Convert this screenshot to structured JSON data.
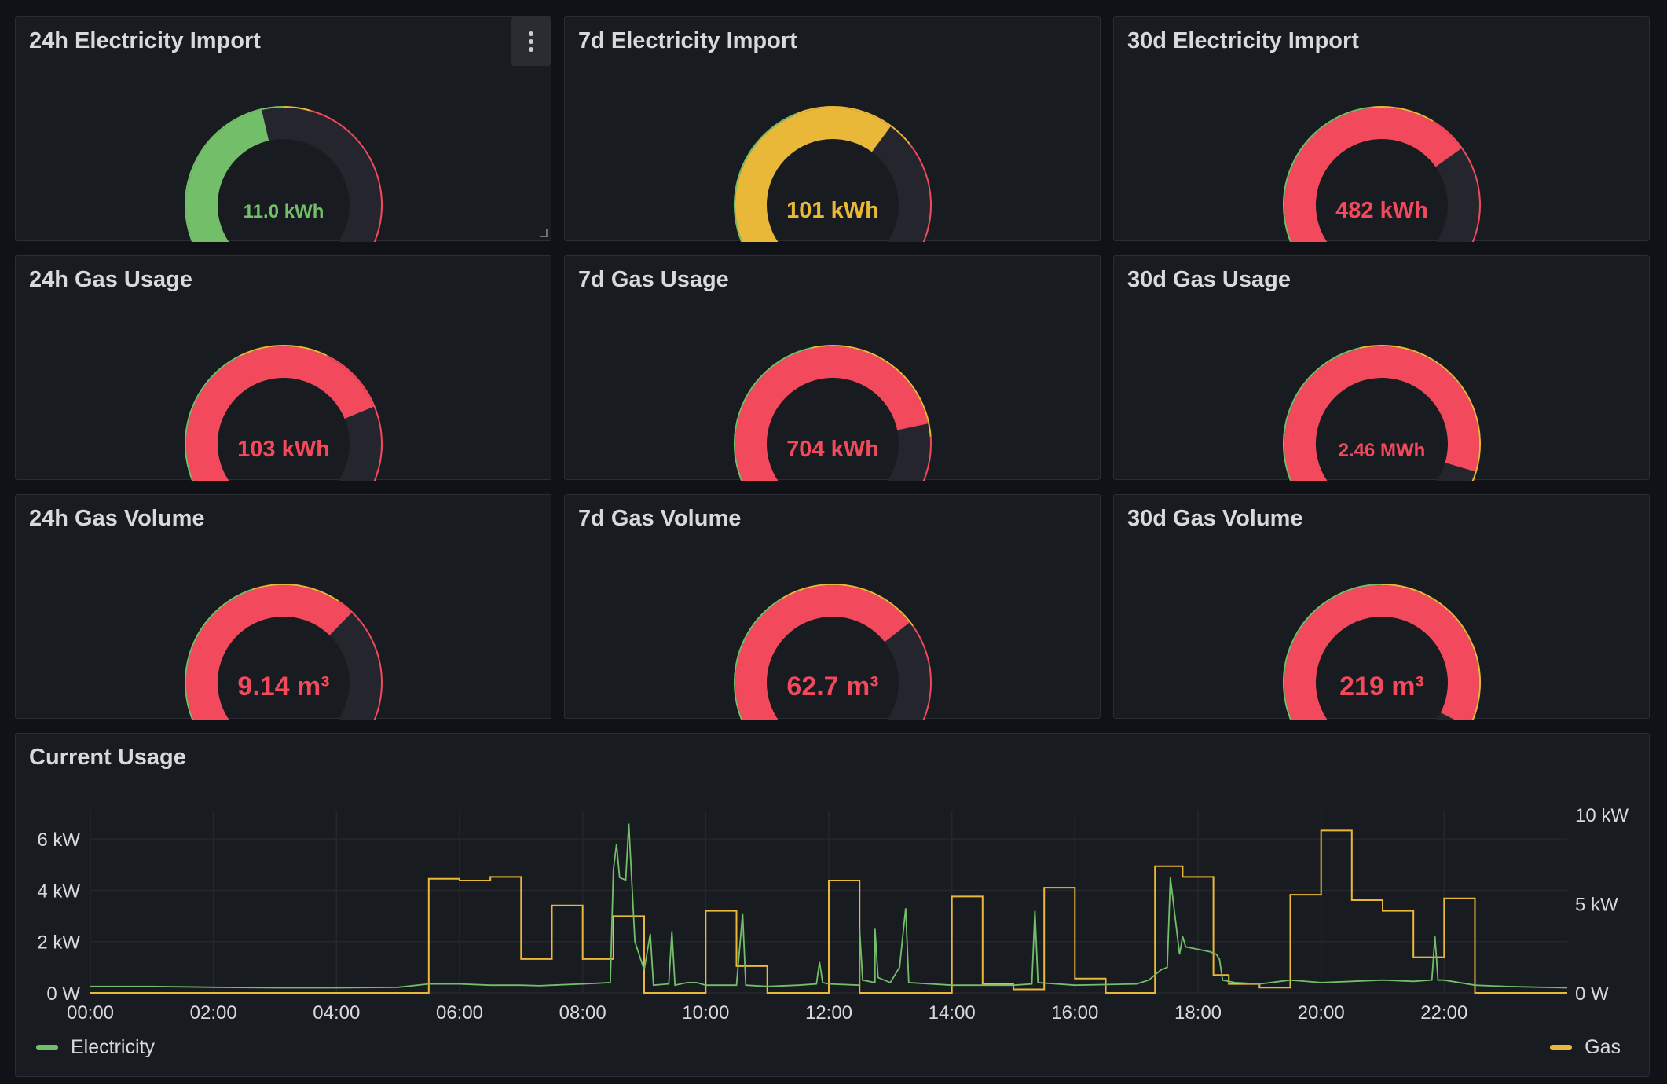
{
  "colors": {
    "green": "#73bf69",
    "yellow": "#eab839",
    "red": "#f2495c",
    "track": "#25262d"
  },
  "gauges": [
    {
      "title": "24h Electricity Import",
      "value": "11.0 kWh",
      "fraction": 0.45,
      "color": "#73bf69",
      "thresholds": [
        0.5,
        0.56
      ]
    },
    {
      "title": "7d Electricity Import",
      "value": "101 kWh",
      "fraction": 0.64,
      "color": "#eab839",
      "thresholds": [
        0.42,
        0.7
      ]
    },
    {
      "title": "30d Electricity Import",
      "value": "482 kWh",
      "fraction": 0.71,
      "color": "#f2495c",
      "thresholds": [
        0.48,
        0.62
      ]
    },
    {
      "title": "24h Gas Usage",
      "value": "103 kWh",
      "fraction": 0.76,
      "color": "#f2495c",
      "thresholds": [
        0.4,
        0.6
      ]
    },
    {
      "title": "7d Gas Usage",
      "value": "704 kWh",
      "fraction": 0.8,
      "color": "#f2495c",
      "thresholds": [
        0.45,
        0.83
      ]
    },
    {
      "title": "30d Gas Usage",
      "value": "2.46 MWh",
      "fraction": 0.91,
      "color": "#f2495c",
      "thresholds": [
        0.45,
        0.97
      ]
    },
    {
      "title": "24h Gas Volume",
      "value": "9.14 m³",
      "fraction": 0.67,
      "color": "#f2495c",
      "thresholds": [
        0.43,
        0.63
      ]
    },
    {
      "title": "7d Gas Volume",
      "value": "62.7 m³",
      "fraction": 0.7,
      "color": "#f2495c",
      "thresholds": [
        0.38,
        0.71
      ]
    },
    {
      "title": "30d Gas Volume",
      "value": "219 m³",
      "fraction": 0.95,
      "color": "#f2495c",
      "thresholds": [
        0.5,
        0.99
      ]
    }
  ],
  "timeseries": {
    "title": "Current Usage",
    "legend": {
      "electricity": "Electricity",
      "gas": "Gas"
    }
  },
  "chart_data": {
    "type": "line",
    "title": "Current Usage",
    "x_ticks": [
      "00:00",
      "02:00",
      "04:00",
      "06:00",
      "08:00",
      "10:00",
      "12:00",
      "14:00",
      "16:00",
      "18:00",
      "20:00",
      "22:00"
    ],
    "x_range_hours": [
      0,
      24
    ],
    "y_left": {
      "ticks": [
        "0 W",
        "2 kW",
        "4 kW",
        "6 kW"
      ],
      "range_kw": [
        0,
        7.2
      ]
    },
    "y_right": {
      "ticks": [
        "0 W",
        "5 kW",
        "10 kW"
      ],
      "range_kw": [
        0,
        10
      ]
    },
    "series": [
      {
        "name": "Gas",
        "axis": "right",
        "color": "#eab839",
        "step_points": [
          [
            0,
            0
          ],
          [
            5.5,
            6.4
          ],
          [
            6.0,
            6.3
          ],
          [
            6.5,
            6.5
          ],
          [
            7.0,
            1.9
          ],
          [
            7.5,
            4.9
          ],
          [
            8.0,
            1.9
          ],
          [
            8.5,
            4.3
          ],
          [
            9.0,
            0
          ],
          [
            10.0,
            4.6
          ],
          [
            10.5,
            1.5
          ],
          [
            11.0,
            0
          ],
          [
            12.0,
            6.3
          ],
          [
            12.5,
            0
          ],
          [
            13.0,
            0
          ],
          [
            13.5,
            0
          ],
          [
            14.0,
            5.4
          ],
          [
            14.5,
            0.5
          ],
          [
            15.0,
            0.2
          ],
          [
            15.5,
            5.9
          ],
          [
            16.0,
            0.8
          ],
          [
            16.5,
            0
          ],
          [
            17.0,
            0
          ],
          [
            17.3,
            7.1
          ],
          [
            17.75,
            6.5
          ],
          [
            18.25,
            1.0
          ],
          [
            18.5,
            0.5
          ],
          [
            19.0,
            0.3
          ],
          [
            19.5,
            5.5
          ],
          [
            20.0,
            9.1
          ],
          [
            20.5,
            5.2
          ],
          [
            21.0,
            4.6
          ],
          [
            21.5,
            2.0
          ],
          [
            22.0,
            5.3
          ],
          [
            22.5,
            0
          ],
          [
            24.0,
            0
          ]
        ]
      },
      {
        "name": "Electricity",
        "axis": "left",
        "color": "#73bf69",
        "points": [
          [
            0,
            0.25
          ],
          [
            1,
            0.25
          ],
          [
            2,
            0.22
          ],
          [
            3,
            0.2
          ],
          [
            4,
            0.2
          ],
          [
            5,
            0.22
          ],
          [
            5.5,
            0.35
          ],
          [
            6,
            0.35
          ],
          [
            6.5,
            0.3
          ],
          [
            7,
            0.3
          ],
          [
            7.3,
            0.28
          ],
          [
            7.5,
            0.3
          ],
          [
            8.0,
            0.35
          ],
          [
            8.45,
            0.4
          ],
          [
            8.5,
            4.8
          ],
          [
            8.55,
            5.8
          ],
          [
            8.6,
            4.5
          ],
          [
            8.7,
            4.4
          ],
          [
            8.75,
            6.6
          ],
          [
            8.8,
            4.3
          ],
          [
            8.85,
            2.0
          ],
          [
            9.0,
            0.9
          ],
          [
            9.1,
            2.3
          ],
          [
            9.15,
            0.3
          ],
          [
            9.4,
            0.35
          ],
          [
            9.45,
            2.4
          ],
          [
            9.5,
            0.3
          ],
          [
            9.7,
            0.4
          ],
          [
            9.85,
            0.4
          ],
          [
            10.0,
            0.3
          ],
          [
            10.5,
            0.3
          ],
          [
            10.6,
            3.1
          ],
          [
            10.65,
            0.3
          ],
          [
            11,
            0.25
          ],
          [
            11.5,
            0.3
          ],
          [
            11.8,
            0.35
          ],
          [
            11.85,
            1.2
          ],
          [
            11.9,
            0.4
          ],
          [
            12.0,
            0.35
          ],
          [
            12.5,
            0.3
          ],
          [
            12.5,
            2.5
          ],
          [
            12.55,
            0.5
          ],
          [
            12.75,
            0.4
          ],
          [
            12.75,
            2.5
          ],
          [
            12.8,
            0.6
          ],
          [
            13.0,
            0.4
          ],
          [
            13.15,
            1.0
          ],
          [
            13.25,
            3.3
          ],
          [
            13.3,
            0.4
          ],
          [
            14,
            0.3
          ],
          [
            15,
            0.3
          ],
          [
            15.3,
            0.35
          ],
          [
            15.35,
            3.2
          ],
          [
            15.4,
            0.4
          ],
          [
            16,
            0.3
          ],
          [
            17,
            0.35
          ],
          [
            17.2,
            0.5
          ],
          [
            17.4,
            0.9
          ],
          [
            17.5,
            1.0
          ],
          [
            17.55,
            4.5
          ],
          [
            17.6,
            3.5
          ],
          [
            17.7,
            1.5
          ],
          [
            17.75,
            2.2
          ],
          [
            17.8,
            1.8
          ],
          [
            18.0,
            1.7
          ],
          [
            18.2,
            1.6
          ],
          [
            18.3,
            1.5
          ],
          [
            18.35,
            1.3
          ],
          [
            18.4,
            0.5
          ],
          [
            18.6,
            0.4
          ],
          [
            19,
            0.35
          ],
          [
            19.5,
            0.5
          ],
          [
            20,
            0.4
          ],
          [
            20.5,
            0.45
          ],
          [
            21,
            0.5
          ],
          [
            21.5,
            0.45
          ],
          [
            21.8,
            0.5
          ],
          [
            21.85,
            2.2
          ],
          [
            21.9,
            0.5
          ],
          [
            22,
            0.5
          ],
          [
            22.5,
            0.3
          ],
          [
            23,
            0.25
          ],
          [
            24,
            0.2
          ]
        ]
      }
    ]
  }
}
